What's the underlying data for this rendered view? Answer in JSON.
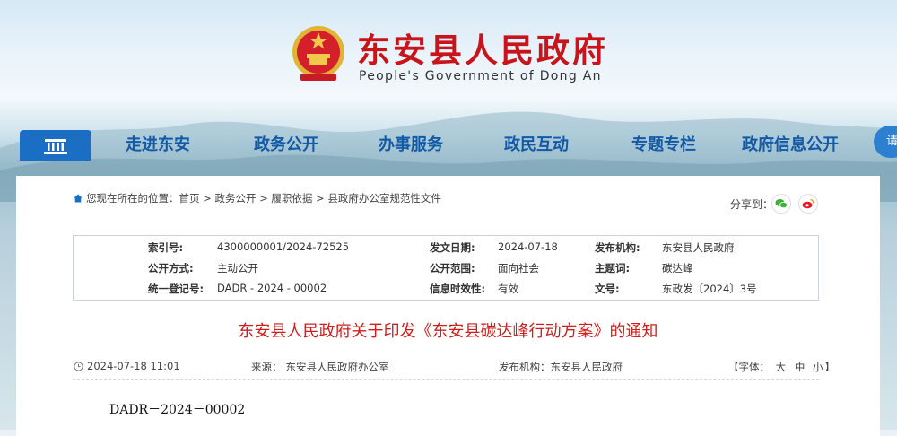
{
  "header": {
    "title": "东安县人民政府",
    "subtitle": "People's Government of Dong An",
    "emblem_icon": "national-emblem-icon"
  },
  "nav": {
    "home_icon": "home-gate-icon",
    "items": [
      "走进东安",
      "政务公开",
      "办事服务",
      "政民互动",
      "专题专栏",
      "政府信息公开"
    ],
    "more_label": "请"
  },
  "breadcrumb": {
    "prefix": "您现在所在的位置：",
    "items": [
      "首页",
      "政务公开",
      "履职依据",
      "县政府办公室规范性文件"
    ],
    "separator": " > "
  },
  "share": {
    "label": "分享到：",
    "icons": [
      "wechat-icon",
      "weibo-icon"
    ]
  },
  "meta": {
    "index_label": "索引号:",
    "index_value": "4300000001/2024-72525",
    "date_label": "发文日期:",
    "date_value": "2024-07-18",
    "org_label": "发布机构:",
    "org_value": "东安县人民政府",
    "mode_label": "公开方式:",
    "mode_value": "主动公开",
    "scope_label": "公开范围:",
    "scope_value": "面向社会",
    "subject_label": "主题词:",
    "subject_value": "碳达峰",
    "code_label": "统一登记号:",
    "code_value": "DADR - 2024 - 00002",
    "valid_label": "信息时效性:",
    "valid_value": "有效",
    "docno_label": "文号:",
    "docno_value": "东政发〔2024〕3号"
  },
  "document": {
    "title": "东安县人民政府关于印发《东安县碳达峰行动方案》的通知",
    "datetime": "2024-07-18 11:01",
    "source_label": "来源：",
    "source_value": "东安县人民政府办公室",
    "publisher": "发布机构：东安县人民政府",
    "font_label": "【字体：",
    "font_sizes": [
      "大",
      "中",
      "小"
    ],
    "font_close": "】",
    "doc_number": "DADR－2024－00002"
  },
  "colors": {
    "brand_red": "#c8141b",
    "nav_blue": "#135aa6",
    "title_red": "#cf1e1e"
  }
}
